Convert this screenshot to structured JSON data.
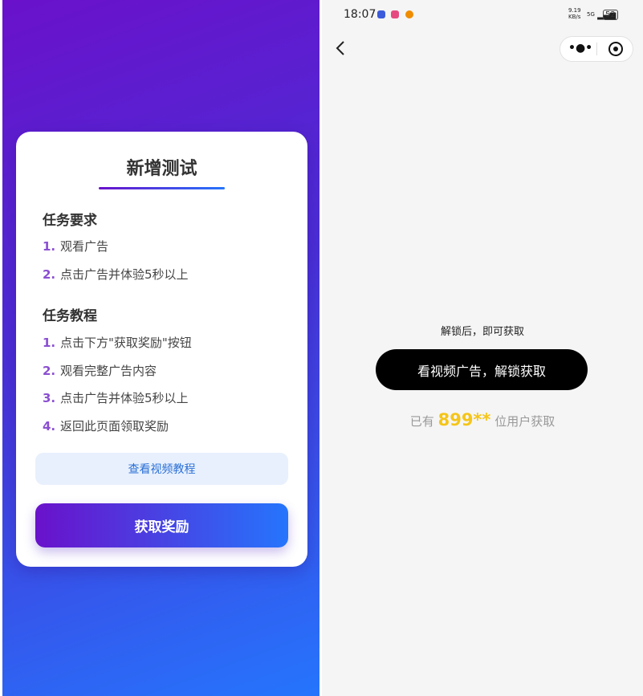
{
  "left_panel": {
    "title": "新增测试",
    "requirements": {
      "heading": "任务要求",
      "items": [
        {
          "num": "1.",
          "text": "观看广告"
        },
        {
          "num": "2.",
          "text": "点击广告并体验5秒以上"
        }
      ]
    },
    "tutorial": {
      "heading": "任务教程",
      "items": [
        {
          "num": "1.",
          "text": "点击下方\"获取奖励\"按钮"
        },
        {
          "num": "2.",
          "text": "观看完整广告内容"
        },
        {
          "num": "3.",
          "text": "点击广告并体验5秒以上"
        },
        {
          "num": "4.",
          "text": "返回此页面领取奖励"
        }
      ]
    },
    "tutorial_button": "查看视频教程",
    "reward_button": "获取奖励",
    "colors": {
      "gradient_start": "#6a11cb",
      "gradient_end": "#2575fc"
    }
  },
  "right_panel": {
    "status_bar": {
      "time": "18:07",
      "net_speed": "9.19\nKB/s",
      "network": "5G",
      "battery": "52"
    },
    "nav": {
      "back_icon": "chevron-left-icon",
      "more_icon": "more-dots-icon",
      "close_icon": "target-circle-icon"
    },
    "hint": "解锁后，即可获取",
    "unlock_button": "看视频广告，解锁获取",
    "count_prefix": "已有",
    "count_value": "899**",
    "count_suffix": "位用户获取",
    "colors": {
      "highlight": "#f5c518",
      "button": "#000000"
    }
  }
}
